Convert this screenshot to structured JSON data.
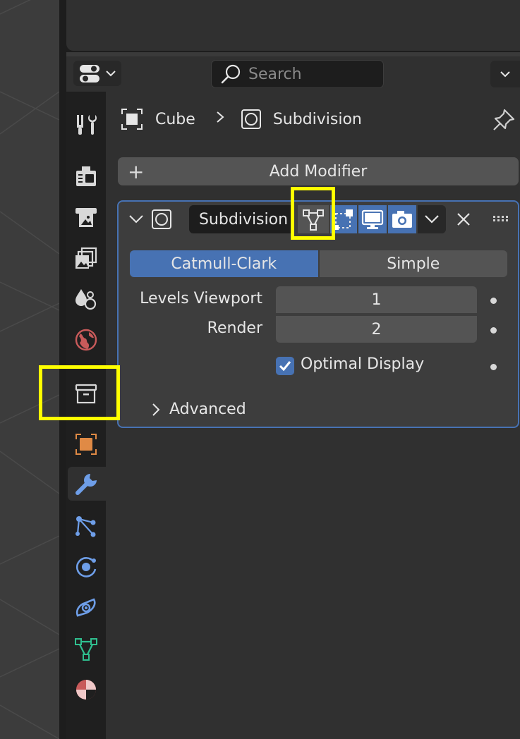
{
  "header": {
    "search_placeholder": "Search"
  },
  "tabs": [
    {
      "icon": "tool-icon",
      "color": "#d8d8d8"
    },
    {
      "icon": "render-icon",
      "color": "#d8d8d8"
    },
    {
      "icon": "output-icon",
      "color": "#d8d8d8"
    },
    {
      "icon": "view-layer-icon",
      "color": "#d8d8d8"
    },
    {
      "icon": "scene-icon",
      "color": "#d8d8d8"
    },
    {
      "icon": "world-icon",
      "color": "#c85a5a"
    },
    {
      "icon": "collection-icon",
      "color": "#d8d8d8"
    },
    {
      "icon": "object-icon",
      "color": "#e08a45"
    },
    {
      "icon": "modifier-wrench-icon",
      "color": "#6e9ee8",
      "active": true
    },
    {
      "icon": "particles-icon",
      "color": "#6e9ee8"
    },
    {
      "icon": "physics-icon",
      "color": "#6e9ee8"
    },
    {
      "icon": "constraints-icon",
      "color": "#6e9ee8"
    },
    {
      "icon": "object-data-icon",
      "color": "#2fbf8f"
    },
    {
      "icon": "material-icon",
      "color": "#c85a5a"
    }
  ],
  "breadcrumb": {
    "object": "Cube",
    "separator": ">",
    "modifier": "Subdivision"
  },
  "add_modifier": {
    "plus": "+",
    "label": "Add Modifier"
  },
  "modifier": {
    "name": "Subdivision",
    "remove": "✕",
    "methods": {
      "catmull": "Catmull-Clark",
      "simple": "Simple",
      "selected": "Catmull-Clark"
    },
    "levels_viewport_label": "Levels Viewport",
    "levels_viewport_value": "1",
    "render_label": "Render",
    "render_value": "2",
    "optimal_display_label": "Optimal Display",
    "optimal_display_checked": true,
    "advanced_label": "Advanced"
  },
  "colors": {
    "accent": "#4772b3",
    "highlight": "#ffff00"
  }
}
